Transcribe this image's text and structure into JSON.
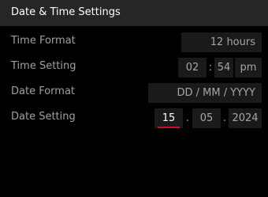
{
  "header": {
    "title": "Date & Time Settings"
  },
  "rows": [
    {
      "label": "Time Format",
      "value": "12 hours"
    },
    {
      "label": "Time Setting",
      "hour": "02",
      "sep": ":",
      "minute": "54",
      "ampm": "pm"
    },
    {
      "label": "Date Format",
      "value": "DD / MM / YYYY"
    },
    {
      "label": "Date Setting",
      "day": "15",
      "month": "05",
      "year": "2024",
      "sep": "."
    }
  ],
  "colors": {
    "header_bg": "#262626",
    "active_underline": "#c8102e"
  }
}
